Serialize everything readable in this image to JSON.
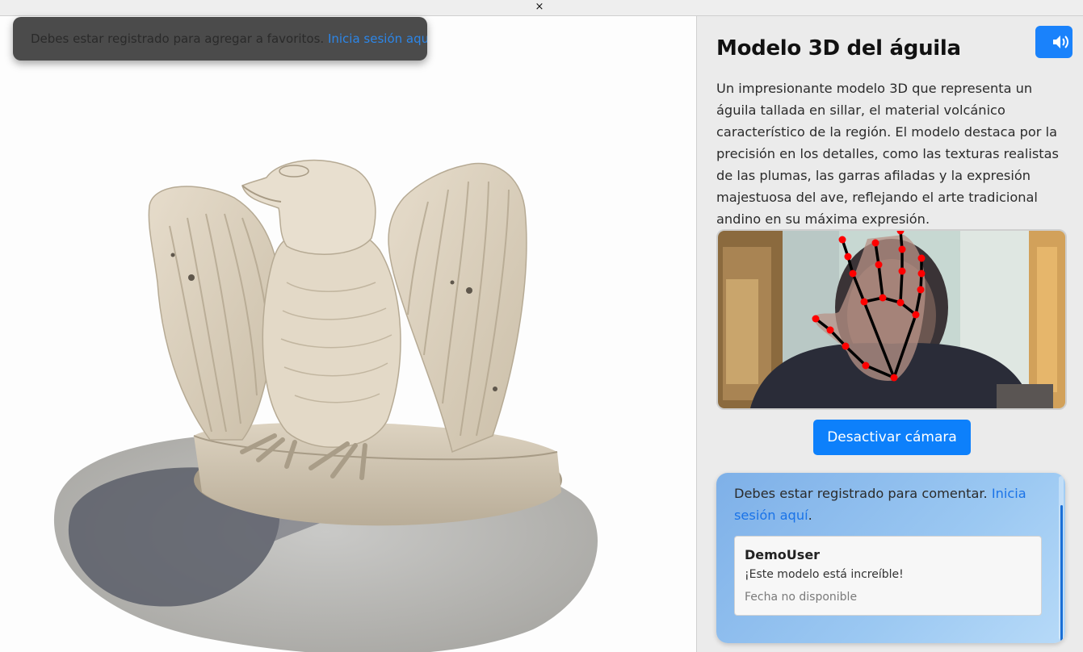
{
  "window": {
    "close_glyph": "×"
  },
  "toast": {
    "message": "Debes estar registrado para agregar a favoritos.",
    "link": "Inicia sesión aquí"
  },
  "model": {
    "title": "Modelo 3D del águila",
    "description": "Un impresionante modelo 3D que representa un águila tallada en sillar, el material volcánico característico de la región. El modelo destaca por la precisión en los detalles, como las texturas realistas de las plumas, las garras afiladas y la expresión majestuosa del ave, reflejando el arte tradicional andino en su máxima expresión.",
    "audio_icon": "speaker-volume-icon"
  },
  "camera": {
    "toggle_label": "Desactivar cámara"
  },
  "comments": {
    "login_message": "Debes estar registrado para comentar.",
    "login_link": "Inicia sesión aquí",
    "login_suffix": ".",
    "items": [
      {
        "user": "DemoUser",
        "text": "¡Este modelo está increíble!",
        "date": "Fecha no disponible"
      }
    ]
  },
  "colors": {
    "accent": "#0d80fb",
    "link": "#1a73e8",
    "toast_bg": "#4b4b4b",
    "landmark": "#ff0000"
  }
}
